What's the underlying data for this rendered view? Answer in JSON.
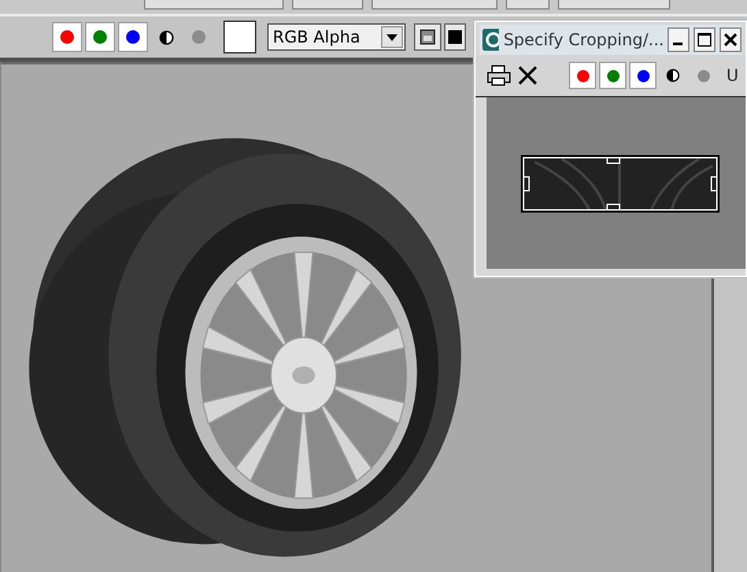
{
  "main_toolbar": {
    "channels": [
      {
        "kind": "dot",
        "color": "#ff0000",
        "on": true
      },
      {
        "kind": "dot",
        "color": "#008000",
        "on": true
      },
      {
        "kind": "dot",
        "color": "#0000ff",
        "on": true
      },
      {
        "kind": "mono",
        "on": false
      },
      {
        "kind": "dot",
        "color": "#8c8c8c",
        "on": false
      }
    ],
    "display_channel": {
      "value": "RGB Alpha"
    }
  },
  "crop_window": {
    "title": "Specify Cropping/...",
    "channels": [
      {
        "kind": "dot",
        "color": "#ff0000",
        "on": true
      },
      {
        "kind": "dot",
        "color": "#008000",
        "on": true
      },
      {
        "kind": "dot",
        "color": "#0000ff",
        "on": true
      },
      {
        "kind": "mono",
        "on": false
      },
      {
        "kind": "dot",
        "color": "#8c8c8c",
        "on": false
      }
    ],
    "cut_label": "U"
  }
}
